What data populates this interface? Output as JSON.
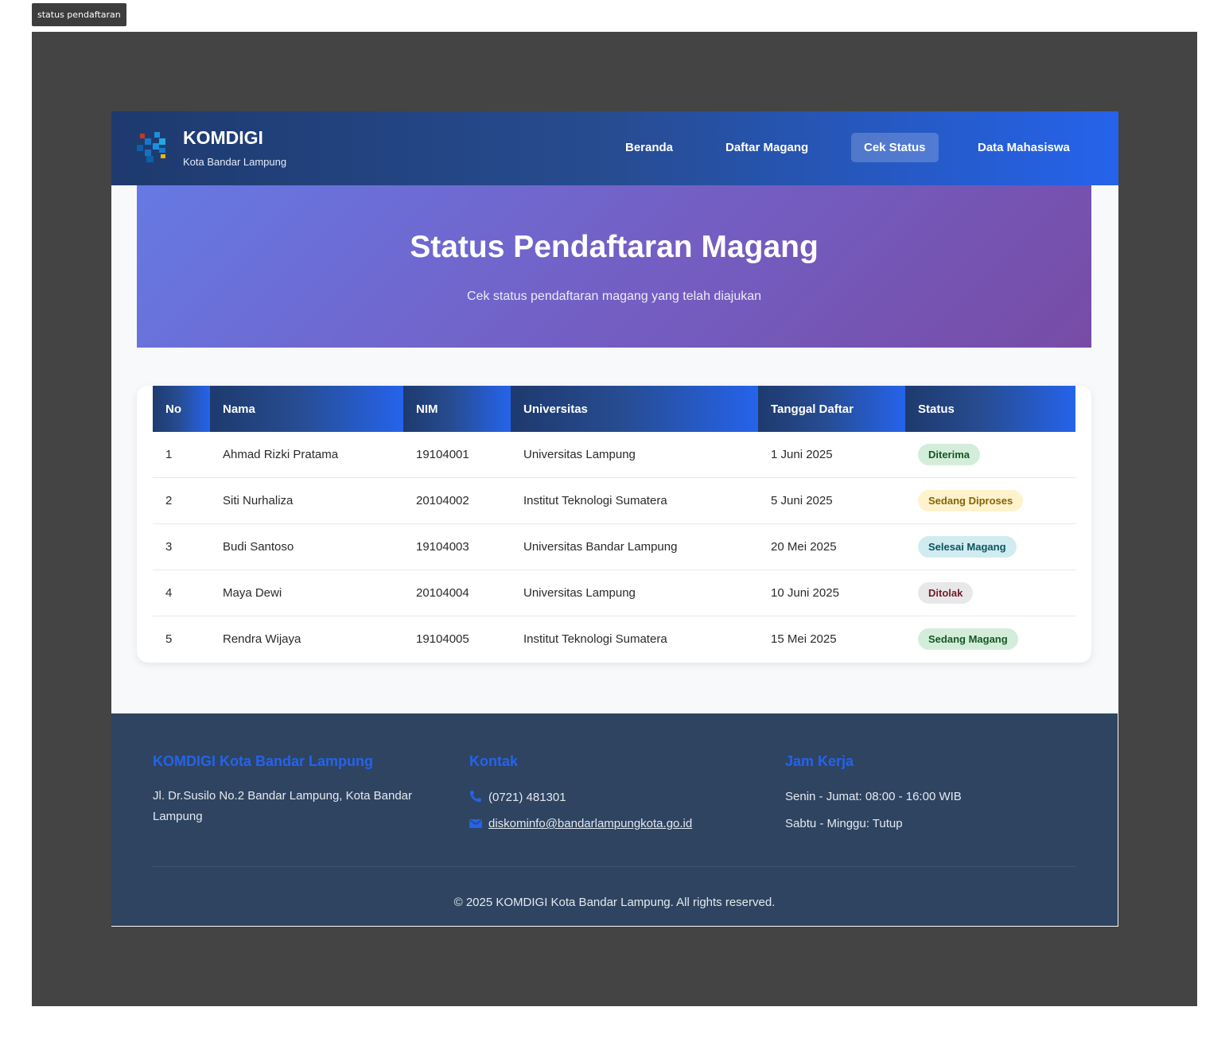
{
  "tab_label": "status pendaftaran",
  "brand": {
    "title": "KOMDIGI",
    "subtitle": "Kota Bandar Lampung"
  },
  "nav": {
    "items": [
      {
        "label": "Beranda"
      },
      {
        "label": "Daftar Magang"
      },
      {
        "label": "Cek Status"
      },
      {
        "label": "Data Mahasiswa"
      }
    ],
    "active": "Cek Status"
  },
  "hero": {
    "title": "Status Pendaftaran Magang",
    "subtitle": "Cek status pendaftaran magang yang telah diajukan"
  },
  "table": {
    "headers": [
      "No",
      "Nama",
      "NIM",
      "Universitas",
      "Tanggal Daftar",
      "Status"
    ],
    "rows": [
      {
        "no": "1",
        "nama": "Ahmad Rizki Pratama",
        "nim": "19104001",
        "universitas": "Universitas Lampung",
        "tanggal": "1 Juni 2025",
        "status": "Diterima",
        "status_color": "#155724"
      },
      {
        "no": "2",
        "nama": "Siti Nurhaliza",
        "nim": "20104002",
        "universitas": "Institut Teknologi Sumatera",
        "tanggal": "5 Juni 2025",
        "status": "Sedang Diproses",
        "status_color": "#856404"
      },
      {
        "no": "3",
        "nama": "Budi Santoso",
        "nim": "19104003",
        "universitas": "Universitas Bandar Lampung",
        "tanggal": "20 Mei 2025",
        "status": "Selesai Magang",
        "status_color": "#0c5460"
      },
      {
        "no": "4",
        "nama": "Maya Dewi",
        "nim": "20104004",
        "universitas": "Universitas Lampung",
        "tanggal": "10 Juni 2025",
        "status": "Ditolak",
        "status_color": "#721c24"
      },
      {
        "no": "5",
        "nama": "Rendra Wijaya",
        "nim": "19104005",
        "universitas": "Institut Teknologi Sumatera",
        "tanggal": "15 Mei 2025",
        "status": "Sedang Magang",
        "status_color": "#155724"
      }
    ]
  },
  "footer": {
    "org_title": "KOMDIGI Kota Bandar Lampung",
    "address": "Jl. Dr.Susilo No.2 Bandar Lampung, Kota Bandar Lampung",
    "contact_title": "Kontak",
    "phone": "(0721) 481301",
    "email": "diskominfo@bandarlampungkota.go.id",
    "hours_title": "Jam Kerja",
    "weekday_hours": "Senin - Jumat: 08:00 - 16:00 WIB",
    "weekend_hours": "Sabtu - Minggu: Tutup",
    "copyright": "© 2025 KOMDIGI Kota Bandar Lampung. All rights reserved."
  },
  "colors": {
    "accent": "#2563eb",
    "nav_dark": "#1e3a6e",
    "footer_bg": "#2e4461",
    "hero_start": "#667eea",
    "hero_end": "#764ba2"
  }
}
